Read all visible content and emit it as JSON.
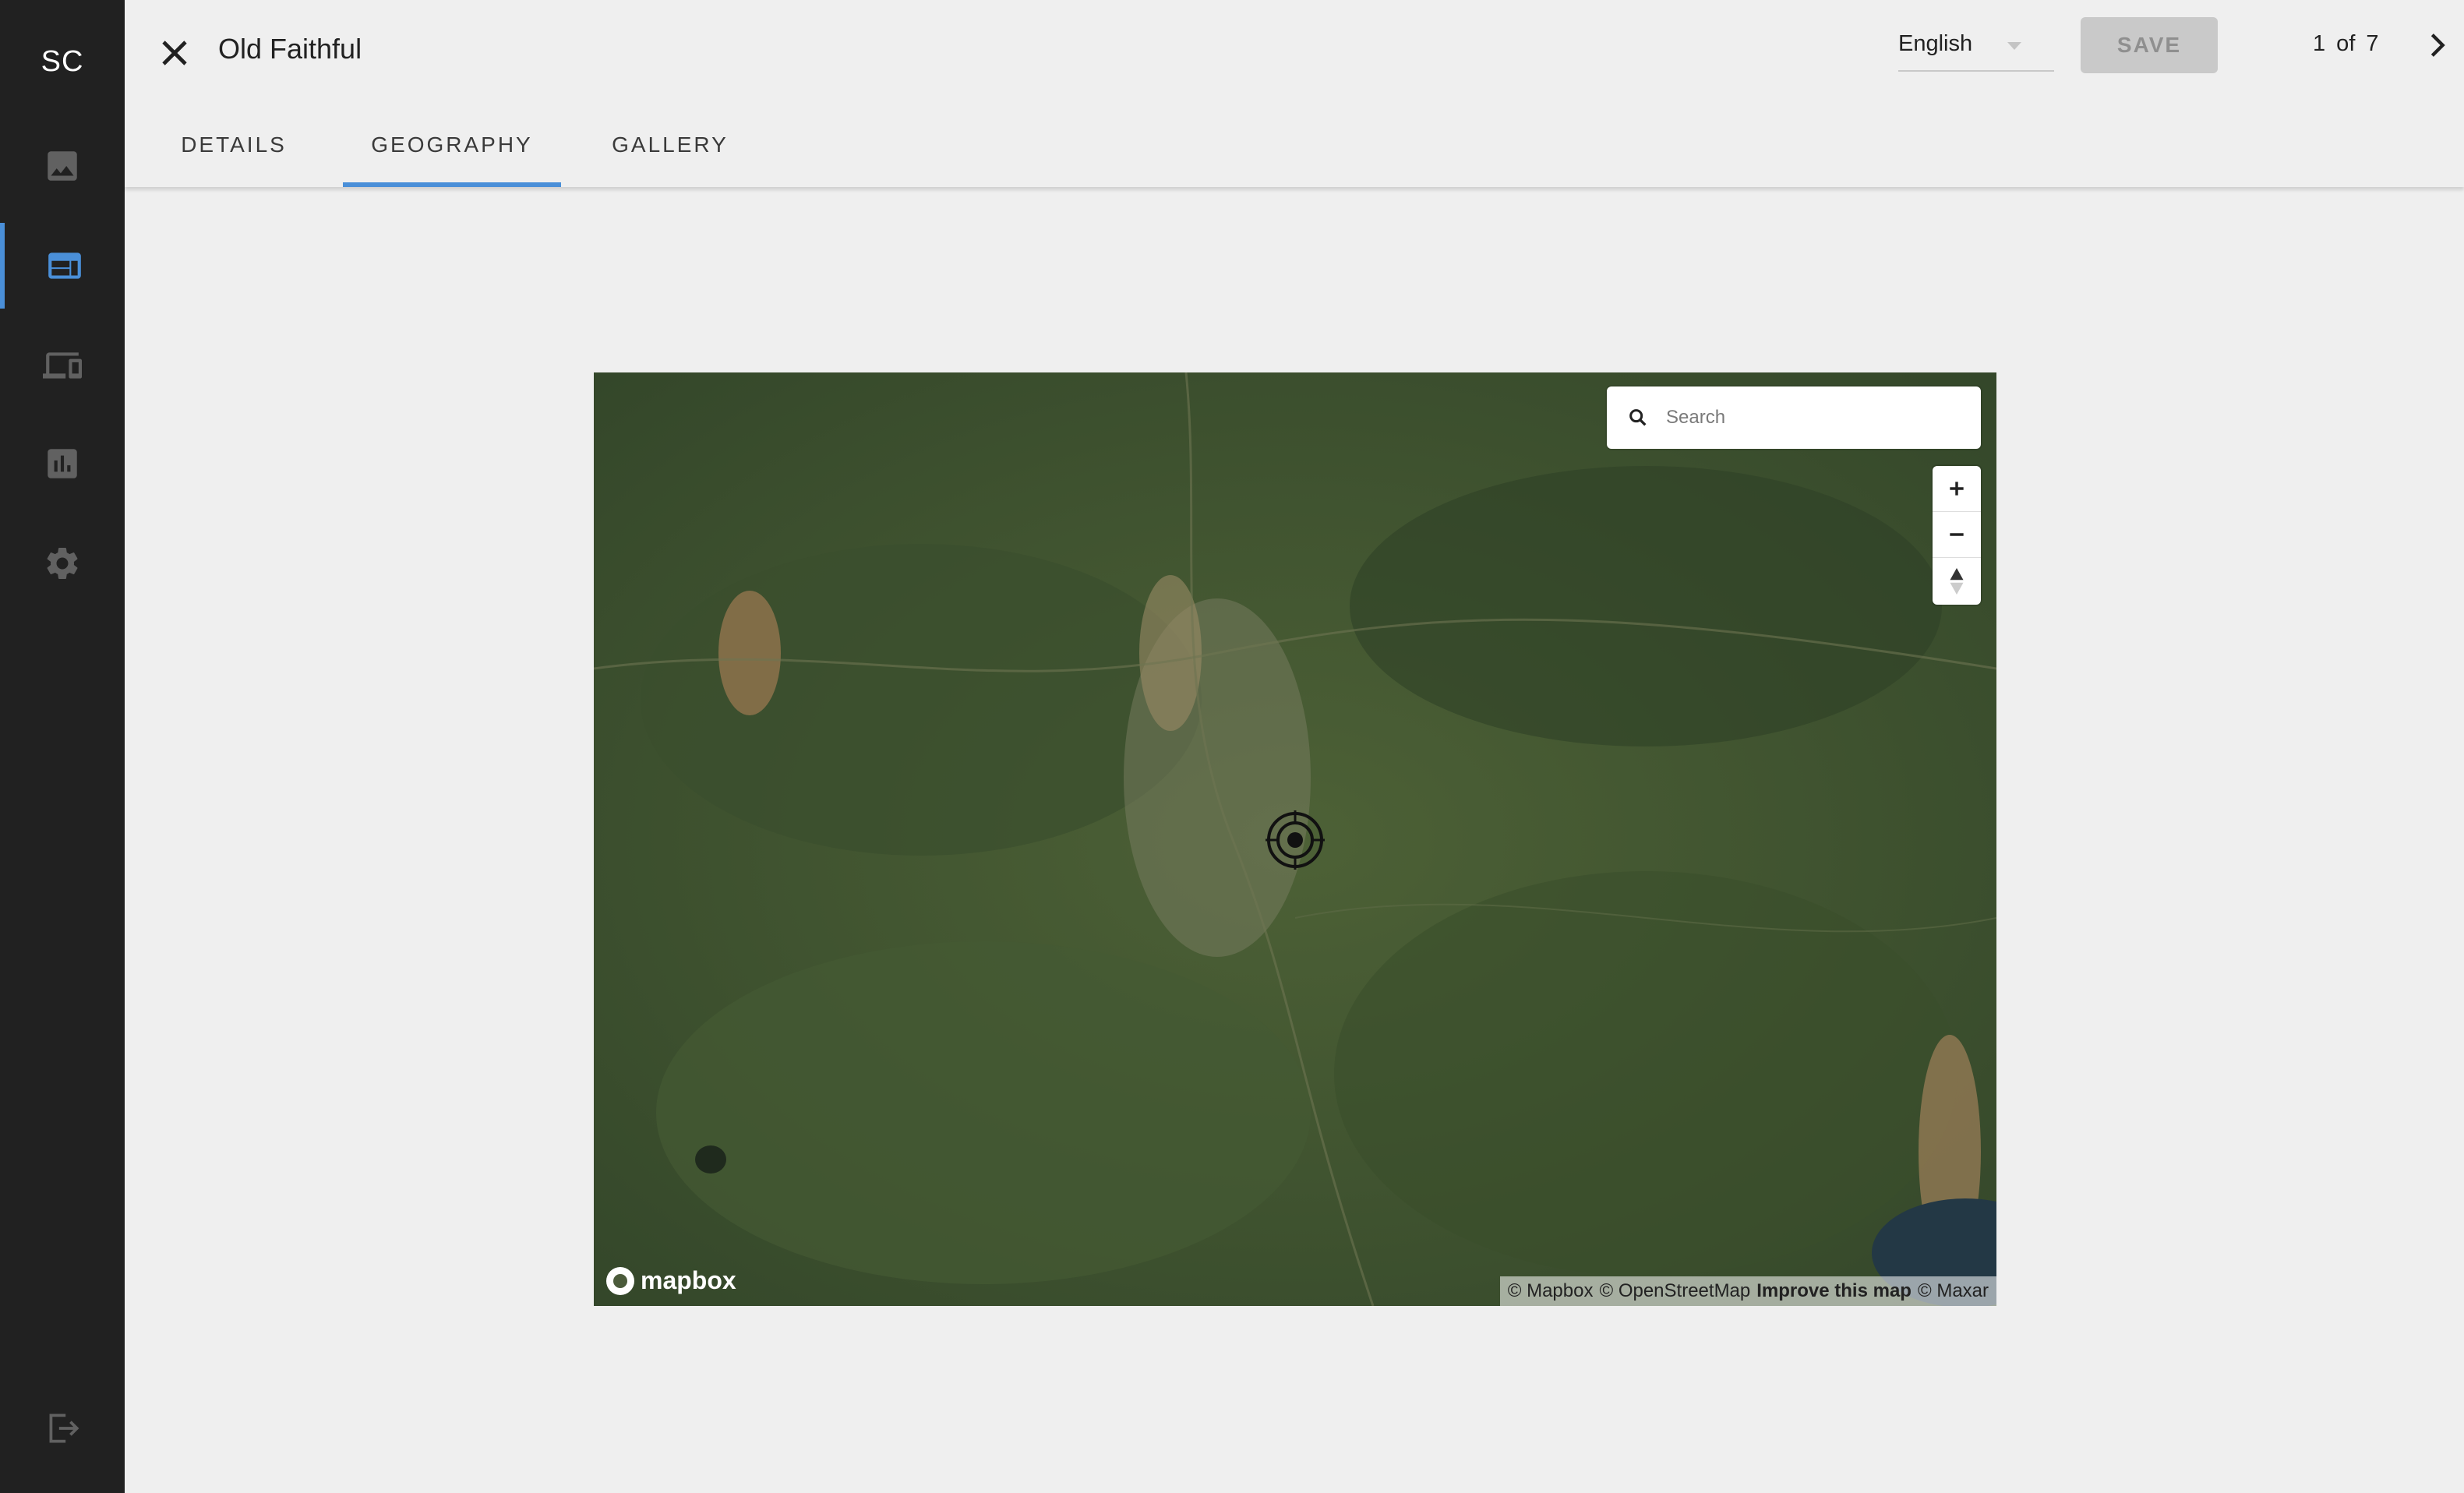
{
  "sidebar": {
    "logo": "SC",
    "items": [
      {
        "icon": "image-icon",
        "active": false
      },
      {
        "icon": "web-layout-icon",
        "active": true
      },
      {
        "icon": "devices-icon",
        "active": false
      },
      {
        "icon": "bar-chart-icon",
        "active": false
      },
      {
        "icon": "gear-icon",
        "active": false
      }
    ],
    "logout_icon": "logout-icon"
  },
  "header": {
    "title": "Old Faithful",
    "language": "English",
    "save_label": "SAVE",
    "pager": "1 of 7"
  },
  "tabs": [
    {
      "label": "DETAILS",
      "active": false
    },
    {
      "label": "GEOGRAPHY",
      "active": true
    },
    {
      "label": "GALLERY",
      "active": false
    }
  ],
  "map": {
    "search_placeholder": "Search",
    "logo": "mapbox",
    "attribution": {
      "mapbox": "© Mapbox",
      "osm": "© OpenStreetMap",
      "improve": "Improve this map",
      "maxar": "© Maxar"
    }
  },
  "colors": {
    "accent": "#4a8fd8",
    "sidebar_bg": "#212121",
    "page_bg": "#efefef",
    "save_disabled_bg": "#c9c9c9"
  }
}
